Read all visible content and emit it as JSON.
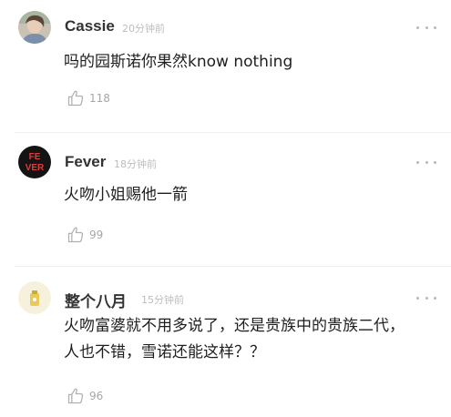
{
  "comments": [
    {
      "username": "Cassie",
      "time": "20分钟前",
      "text": "吗的园斯诺你果然know nothing",
      "likes": "118"
    },
    {
      "username": "Fever",
      "time": "18分钟前",
      "text": "火吻小姐赐他一箭",
      "likes": "99",
      "avatar_text": "FEVER"
    },
    {
      "username": "整个八月",
      "time": "15分钟前",
      "text": "火吻富婆就不用多说了，还是贵族中的贵族二代，\n人也不错，雪诺还能这样？？",
      "likes": "96"
    }
  ],
  "icons": {
    "like": "thumbs-up-icon",
    "more": "more-horizontal-icon"
  },
  "colors": {
    "name": "#333333",
    "time": "#bdbdbd",
    "text": "#1e1e1e",
    "icon": "#b0b0b0",
    "divider": "#eeeeee"
  }
}
